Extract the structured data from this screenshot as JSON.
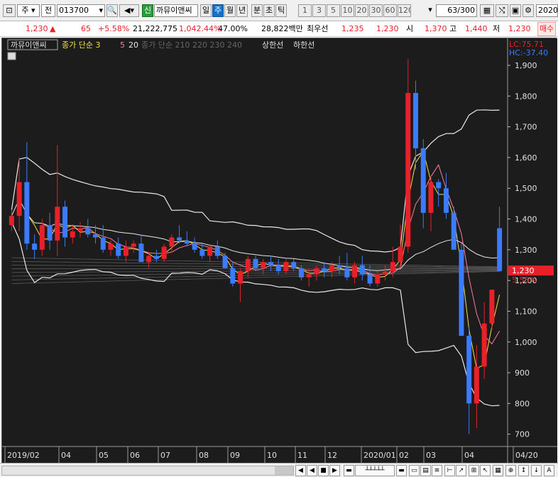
{
  "toolbar": {
    "market": "주",
    "period_select": "전",
    "code": "013700",
    "sin_badge": "신",
    "name": "까뮤이앤씨",
    "periods": [
      "일",
      "주",
      "월",
      "년",
      "분",
      "초",
      "틱"
    ],
    "active_period": "주",
    "intervals": [
      "1",
      "3",
      "5",
      "10",
      "20",
      "30",
      "60",
      "120"
    ],
    "count": "63",
    "total": "/300",
    "date": "2020."
  },
  "quote": {
    "price": "1,230",
    "arrow": "▲",
    "change": "65",
    "change_pct": "+5.58%",
    "volume": "21,222,775",
    "volume_pct": "1,042.44%",
    "ratio": "47.00%",
    "amount": "28,822백만",
    "pref_label": "최우선",
    "pref_ask": "1,235",
    "pref_bid": "1,230",
    "open_label": "시",
    "open": "1,370",
    "high_label": "고",
    "high": "1,440",
    "low_label": "저",
    "low": "1,230",
    "trade_label": "매수"
  },
  "chart": {
    "stock_label": "까뮤이앤씨",
    "ma_label": "종가 단순 3",
    "ma_5": "5",
    "ma_20": "20",
    "ma_long": "종가 단순 210  220  230  240",
    "upper_limit": "상한선",
    "lower_limit": "하한선",
    "lc": "LC:75.71",
    "hc": "HC:-37.40",
    "current_price": "1,230",
    "current_pct": "5.58%"
  },
  "chart_data": {
    "type": "candlestick",
    "y_ticks": [
      "1,900",
      "1,800",
      "1,700",
      "1,600",
      "1,500",
      "1,400",
      "1,300",
      "1,200",
      "1,100",
      "1,000",
      "900",
      "800",
      "700"
    ],
    "ylim": [
      660,
      1960
    ],
    "x_ticks": [
      "2019/02",
      "04",
      "05",
      "06",
      "07",
      "08",
      "09",
      "10",
      "11",
      "12",
      "2020/01",
      "02",
      "03",
      "04",
      "04/20"
    ],
    "candles": [
      [
        1380,
        1430,
        1360,
        1410
      ],
      [
        1410,
        1600,
        1360,
        1520
      ],
      [
        1520,
        1650,
        1300,
        1320
      ],
      [
        1320,
        1350,
        1270,
        1300
      ],
      [
        1300,
        1400,
        1280,
        1380
      ],
      [
        1380,
        1420,
        1300,
        1330
      ],
      [
        1330,
        1640,
        1280,
        1440
      ],
      [
        1440,
        1460,
        1310,
        1340
      ],
      [
        1340,
        1380,
        1320,
        1360
      ],
      [
        1360,
        1390,
        1340,
        1370
      ],
      [
        1370,
        1400,
        1340,
        1350
      ],
      [
        1350,
        1380,
        1320,
        1340
      ],
      [
        1340,
        1380,
        1290,
        1300
      ],
      [
        1300,
        1330,
        1280,
        1320
      ],
      [
        1320,
        1340,
        1270,
        1280
      ],
      [
        1280,
        1330,
        1260,
        1310
      ],
      [
        1310,
        1330,
        1290,
        1320
      ],
      [
        1320,
        1350,
        1300,
        1260
      ],
      [
        1260,
        1290,
        1240,
        1280
      ],
      [
        1280,
        1300,
        1260,
        1270
      ],
      [
        1270,
        1320,
        1260,
        1310
      ],
      [
        1310,
        1350,
        1290,
        1340
      ],
      [
        1340,
        1380,
        1320,
        1330
      ],
      [
        1330,
        1360,
        1310,
        1320
      ],
      [
        1320,
        1340,
        1290,
        1300
      ],
      [
        1300,
        1320,
        1270,
        1280
      ],
      [
        1280,
        1320,
        1260,
        1310
      ],
      [
        1310,
        1330,
        1270,
        1280
      ],
      [
        1280,
        1290,
        1240,
        1240
      ],
      [
        1240,
        1260,
        1180,
        1190
      ],
      [
        1190,
        1240,
        1130,
        1230
      ],
      [
        1230,
        1280,
        1210,
        1270
      ],
      [
        1270,
        1280,
        1230,
        1240
      ],
      [
        1240,
        1270,
        1220,
        1260
      ],
      [
        1260,
        1280,
        1230,
        1250
      ],
      [
        1250,
        1270,
        1220,
        1230
      ],
      [
        1230,
        1270,
        1220,
        1260
      ],
      [
        1260,
        1270,
        1230,
        1240
      ],
      [
        1240,
        1250,
        1200,
        1210
      ],
      [
        1210,
        1240,
        1180,
        1220
      ],
      [
        1220,
        1250,
        1200,
        1240
      ],
      [
        1240,
        1260,
        1210,
        1230
      ],
      [
        1230,
        1260,
        1210,
        1250
      ],
      [
        1250,
        1280,
        1220,
        1240
      ],
      [
        1240,
        1290,
        1200,
        1210
      ],
      [
        1210,
        1260,
        1190,
        1250
      ],
      [
        1250,
        1280,
        1200,
        1220
      ],
      [
        1220,
        1250,
        1180,
        1190
      ],
      [
        1190,
        1230,
        1180,
        1220
      ],
      [
        1220,
        1250,
        1200,
        1230
      ],
      [
        1230,
        1310,
        1210,
        1260
      ],
      [
        1260,
        1380,
        1240,
        1310
      ],
      [
        1310,
        1920,
        1290,
        1810
      ],
      [
        1810,
        1850,
        1560,
        1630
      ],
      [
        1630,
        1660,
        1370,
        1420
      ],
      [
        1420,
        1540,
        1360,
        1520
      ],
      [
        1520,
        1530,
        1440,
        1500
      ],
      [
        1500,
        1550,
        1400,
        1420
      ],
      [
        1420,
        1440,
        1340,
        1300
      ],
      [
        1300,
        1320,
        1150,
        1020
      ],
      [
        1020,
        1050,
        700,
        800
      ],
      [
        800,
        990,
        720,
        920
      ],
      [
        920,
        1130,
        880,
        1060
      ],
      [
        1060,
        1170,
        1040,
        1170
      ],
      [
        1370,
        1440,
        1230,
        1230
      ]
    ]
  }
}
